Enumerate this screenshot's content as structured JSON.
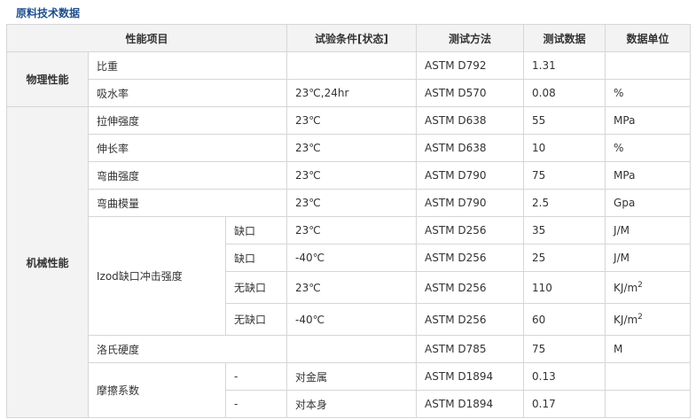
{
  "page_title": "原料技术数据",
  "headers": [
    "性能项目",
    "试验条件[状态]",
    "测试方法",
    "测试数据",
    "数据单位"
  ],
  "categories": {
    "physical": "物理性能",
    "mechanical": "机械性能"
  },
  "rows": [
    {
      "prop": "比重",
      "cond": "",
      "method": "ASTM D792",
      "value": "1.31",
      "unit": ""
    },
    {
      "prop": "吸水率",
      "cond": "23℃,24hr",
      "method": "ASTM D570",
      "value": "0.08",
      "unit": "%"
    },
    {
      "prop": "拉伸强度",
      "cond": "23℃",
      "method": "ASTM D638",
      "value": "55",
      "unit": "MPa"
    },
    {
      "prop": "伸长率",
      "cond": "23℃",
      "method": "ASTM D638",
      "value": "10",
      "unit": "%"
    },
    {
      "prop": "弯曲强度",
      "cond": "23℃",
      "method": "ASTM D790",
      "value": "75",
      "unit": "MPa"
    },
    {
      "prop": "弯曲模量",
      "cond": "23℃",
      "method": "ASTM D790",
      "value": "2.5",
      "unit": "Gpa"
    }
  ],
  "izod": {
    "label": "Izod缺口冲击强度",
    "rows": [
      {
        "sub": "缺口",
        "cond": "23℃",
        "method": "ASTM D256",
        "value": "35",
        "unit": "J/M"
      },
      {
        "sub": "缺口",
        "cond": "-40℃",
        "method": "ASTM D256",
        "value": "25",
        "unit": "J/M"
      },
      {
        "sub": "无缺口",
        "cond": "23℃",
        "method": "ASTM D256",
        "value": "110",
        "unit": "KJ/m",
        "unit_sup": "2"
      },
      {
        "sub": "无缺口",
        "cond": "-40℃",
        "method": "ASTM D256",
        "value": "60",
        "unit": "KJ/m",
        "unit_sup": "2"
      }
    ]
  },
  "rockwell": {
    "prop": "洛氏硬度",
    "cond": "",
    "method": "ASTM D785",
    "value": "75",
    "unit": "M"
  },
  "friction": {
    "label": "摩擦系数",
    "rows": [
      {
        "sub": "-",
        "cond": "对金属",
        "method": "ASTM D1894",
        "value": "0.13",
        "unit": ""
      },
      {
        "sub": "-",
        "cond": "对本身",
        "method": "ASTM D1894",
        "value": "0.17",
        "unit": ""
      }
    ]
  }
}
